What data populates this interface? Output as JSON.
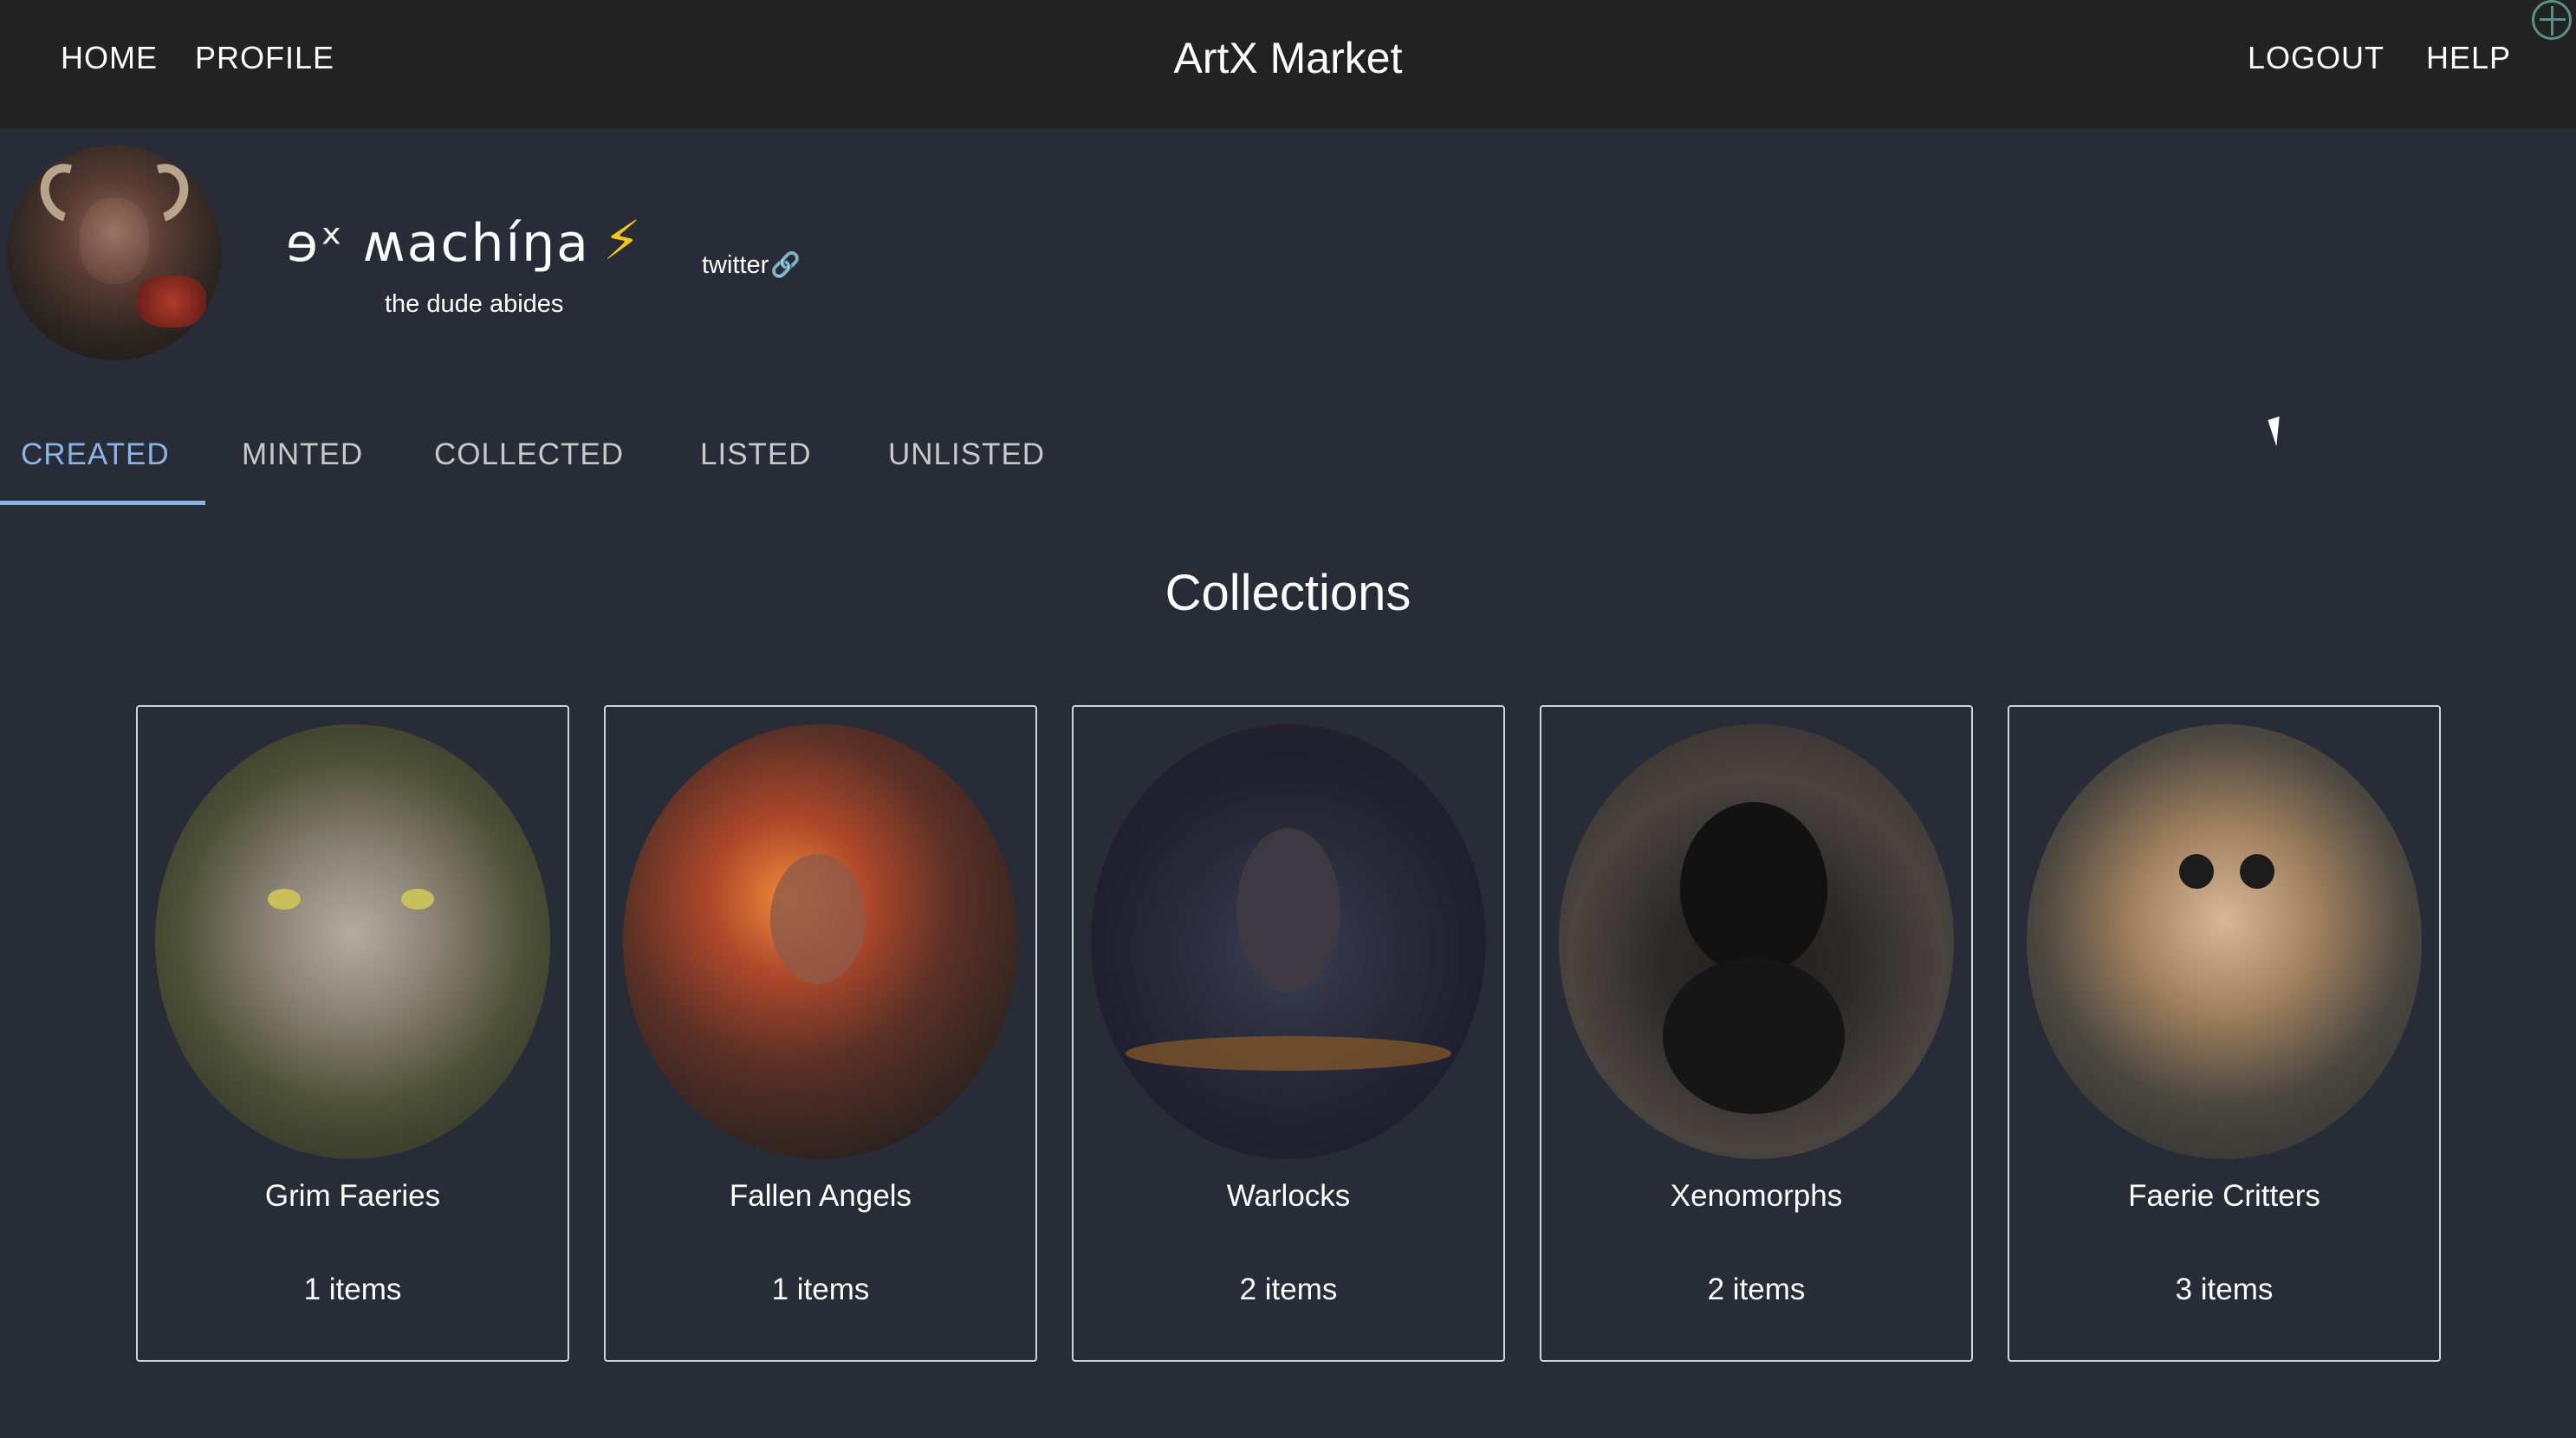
{
  "header": {
    "brand": "ArtX Market",
    "nav_left": [
      "HOME",
      "PROFILE"
    ],
    "nav_right": [
      "LOGOUT",
      "HELP"
    ]
  },
  "profile": {
    "name": "ɘˣ ʍachíŋa",
    "badge": "⚡",
    "tagline": "the dude abides",
    "social_label": "twitter",
    "social_icon": "link-icon"
  },
  "tabs": [
    "CREATED",
    "MINTED",
    "COLLECTED",
    "LISTED",
    "UNLISTED"
  ],
  "active_tab": "CREATED",
  "section_title": "Collections",
  "collections": [
    {
      "title": "Grim Faeries",
      "count": "1 items"
    },
    {
      "title": "Fallen Angels",
      "count": "1 items"
    },
    {
      "title": "Warlocks",
      "count": "2 items"
    },
    {
      "title": "Xenomorphs",
      "count": "2 items"
    },
    {
      "title": "Faerie Critters",
      "count": "3 items"
    }
  ],
  "colors": {
    "background": "#282c37",
    "header": "#222222",
    "accent": "#8ab4e6",
    "bolt": "#f5c518"
  }
}
